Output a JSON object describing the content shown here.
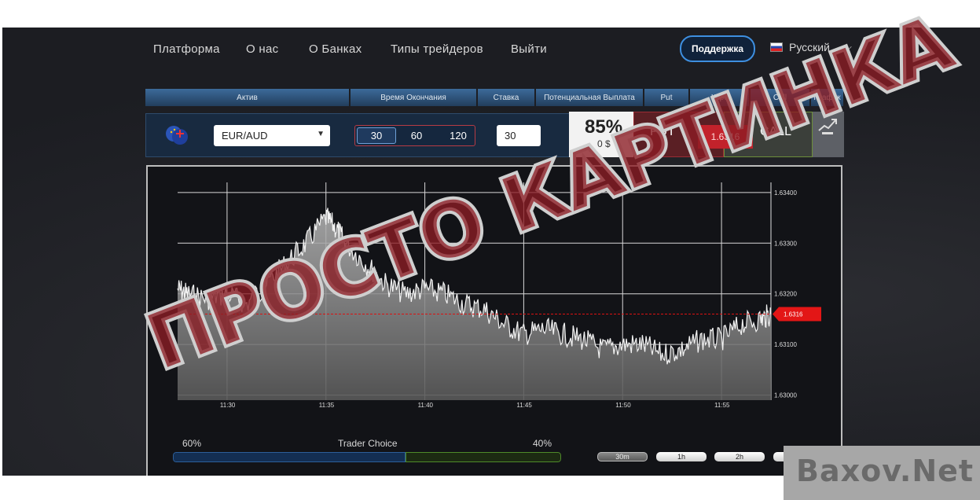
{
  "nav": {
    "items": [
      "Платформа",
      "О нас",
      "О Банках",
      "Типы трейдеров",
      "Выйти"
    ],
    "support_label": "Поддержка",
    "language": "Русский"
  },
  "table": {
    "headers": [
      "Актив",
      "Время Окончания",
      "Ставка",
      "Потенциальная Выплата",
      "Put",
      "Курс",
      "Call",
      "График"
    ],
    "asset": "EUR/AUD",
    "expiry_options": [
      "30",
      "60",
      "120"
    ],
    "expiry_selected": "30",
    "stake": "30",
    "payout_percent": "85%",
    "payout_amount": "0 $",
    "put_label": "PUT",
    "rate": "1.6316",
    "call_label": "CALL"
  },
  "chart_data": {
    "type": "line",
    "x_ticks": [
      "11:30",
      "11:35",
      "11:40",
      "11:45",
      "11:50",
      "11:55"
    ],
    "y_ticks": [
      "1.63400",
      "1.63300",
      "1.63200",
      "1.63100",
      "1.63000"
    ],
    "ylim": [
      1.6299,
      1.6342
    ],
    "current_rate": 1.6316,
    "current_rate_label": "1.6316",
    "series": [
      {
        "x": [
          "11:27:30",
          "11:28",
          "11:29",
          "11:30",
          "11:31",
          "11:32",
          "11:33",
          "11:34",
          "11:35",
          "11:35:30",
          "11:36",
          "11:37",
          "11:38",
          "11:39",
          "11:40",
          "11:41",
          "11:42",
          "11:43",
          "11:44",
          "11:45",
          "11:46",
          "11:47",
          "11:48",
          "11:49",
          "11:50",
          "11:51",
          "11:52",
          "11:53",
          "11:54",
          "11:55",
          "11:56",
          "11:57",
          "11:57:30"
        ],
        "values": [
          1.6321,
          1.632,
          1.6319,
          1.632,
          1.6318,
          1.6322,
          1.6326,
          1.633,
          1.6335,
          1.6333,
          1.633,
          1.6326,
          1.6322,
          1.632,
          1.6321,
          1.632,
          1.6318,
          1.6317,
          1.6314,
          1.6312,
          1.6313,
          1.6312,
          1.6311,
          1.6309,
          1.631,
          1.631,
          1.6308,
          1.6309,
          1.6311,
          1.6311,
          1.6314,
          1.6315,
          1.6316
        ]
      }
    ],
    "grid": true
  },
  "trader_choice": {
    "title": "Trader Choice",
    "put_percent": "60%",
    "call_percent": "40%",
    "put_fraction": 0.6
  },
  "timeframes": [
    "30m",
    "1h",
    "2h",
    "4h"
  ],
  "timeframe_selected": "30m",
  "watermark": "ПРОСТО КАРТИНКА",
  "logo": "Baxov.Net",
  "colors": {
    "put": "#c2222b",
    "call": "#6d8f3a",
    "accent": "#3e8fe0"
  }
}
